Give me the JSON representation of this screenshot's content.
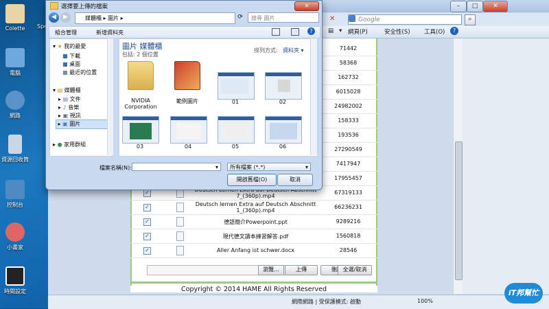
{
  "desktop": {
    "icons": [
      {
        "label": "Colette",
        "color": "#e9d4a6"
      },
      {
        "label": "電腦",
        "color": "#6fa8dc"
      },
      {
        "label": "網路",
        "color": "#5a93c9"
      },
      {
        "label": "資源回收筒",
        "color": "#c9d6e3"
      },
      {
        "label": "控制台",
        "color": "#4f89c4"
      },
      {
        "label": "小畫家",
        "color": "#e06666"
      },
      {
        "label": "時間設定",
        "color": "#222222"
      }
    ],
    "partial_label": "Spe"
  },
  "browser": {
    "search_placeholder": "Google",
    "commands": [
      "網頁(P)",
      "安全性(S)",
      "工具(O)"
    ],
    "rows": [
      {
        "name": "",
        "size": "71442"
      },
      {
        "name": "",
        "size": "58368"
      },
      {
        "name": "",
        "size": "162732"
      },
      {
        "name": "",
        "size": "6015028"
      },
      {
        "name": "",
        "size": "24982002"
      },
      {
        "name": "",
        "size": "158333"
      },
      {
        "name": "",
        "size": "193536"
      },
      {
        "name": "",
        "size": "27290549"
      },
      {
        "name": "",
        "size": "7417947"
      },
      {
        "name": "",
        "size": "17955457"
      },
      {
        "name": "Deutsch Lernen Extra auf Deutsch Abschnitt 7_(360p).mp4",
        "size": "67319133"
      },
      {
        "name": "Deutsch lernen Extra auf Deutsch Abschnitt 1_(360p).mp4",
        "size": "66236231"
      },
      {
        "name": "德語簡介Powerpoint.ppt",
        "size": "9289216"
      },
      {
        "name": "現代德文讀本練習解答.pdf",
        "size": "1560818"
      },
      {
        "name": "Aller Anfang ist schwer.docx",
        "size": "28546"
      }
    ],
    "buttons": {
      "browse": "瀏覽...",
      "upload": "上傳",
      "delete": "刪除",
      "select_all": "全選/取消"
    },
    "copyright": "Copyright © 2014 HAME All Rights Reserved",
    "status": {
      "zone": "網際網路 | 受保護模式: 啟動",
      "zoom": "100%"
    }
  },
  "dialog": {
    "title": "選擇要上傳的檔案",
    "path": [
      "媒體櫃",
      "圖片"
    ],
    "search_placeholder": "搜尋 圖片",
    "toolbar": {
      "organize": "組合管理",
      "new_folder": "新增資料夾"
    },
    "tree": {
      "favorites": "我的最愛",
      "download": "下載",
      "desktop": "桌面",
      "recent": "最近的位置",
      "library": "媒體櫃",
      "docs": "文件",
      "music": "音樂",
      "video": "視訊",
      "pictures": "圖片",
      "homegroup": "家用群組"
    },
    "library_title": "圖片 媒體櫃",
    "includes": "包括: 2 個位置",
    "sort_label": "排列方式:",
    "sort_value": "資料夾",
    "items": [
      {
        "label": "NVIDIA Corporation"
      },
      {
        "label": "範例圖片"
      },
      {
        "label": "01"
      },
      {
        "label": "02"
      },
      {
        "label": "03"
      },
      {
        "label": "04"
      },
      {
        "label": "05"
      },
      {
        "label": "06"
      }
    ],
    "filename_label": "檔案名稱(N):",
    "filetype": "所有檔案 (*.*)",
    "open_btn": "開啟舊檔(O)",
    "cancel_btn": "取消"
  },
  "watermark": "iT邦幫忙"
}
